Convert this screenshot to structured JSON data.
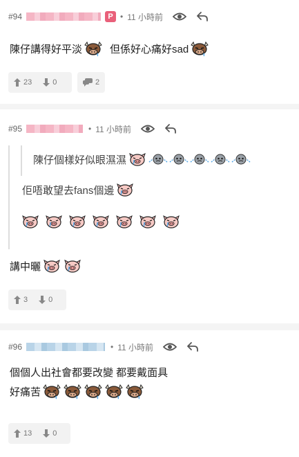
{
  "posts": [
    {
      "number": "#94",
      "time": "11 小時前",
      "text_a": "陳仔講得好平淡",
      "text_b": "但係好心痛好sad",
      "likes": "23",
      "dislikes": "0",
      "replies": "2"
    },
    {
      "number": "#95",
      "time": "11 小時前",
      "quote_inner": "陳仔個樣好似眼濕濕",
      "quote_outer": "佢唔敢望去fans個邊",
      "text": "講中曬",
      "likes": "3",
      "dislikes": "0"
    },
    {
      "number": "#96",
      "time": "11 小時前",
      "line1": "個個人出社會都要改變 都要戴面具",
      "line2": "好痛苦",
      "likes": "13",
      "dislikes": "0"
    }
  ],
  "separator_dot": "•",
  "poster_badge": "P",
  "icons": [
    "eye-icon",
    "reply-arrow-icon",
    "thumbs-up-arrow-icon",
    "thumbs-down-arrow-icon",
    "comment-icon",
    "cow-emoji",
    "pig-cry-emoji",
    "pig-sad-emoji",
    "gray-face-emoji"
  ],
  "colors": {
    "badge": "#e9607a",
    "pink_name": "#f3a9bb",
    "blue_name": "#b9d4e8"
  }
}
